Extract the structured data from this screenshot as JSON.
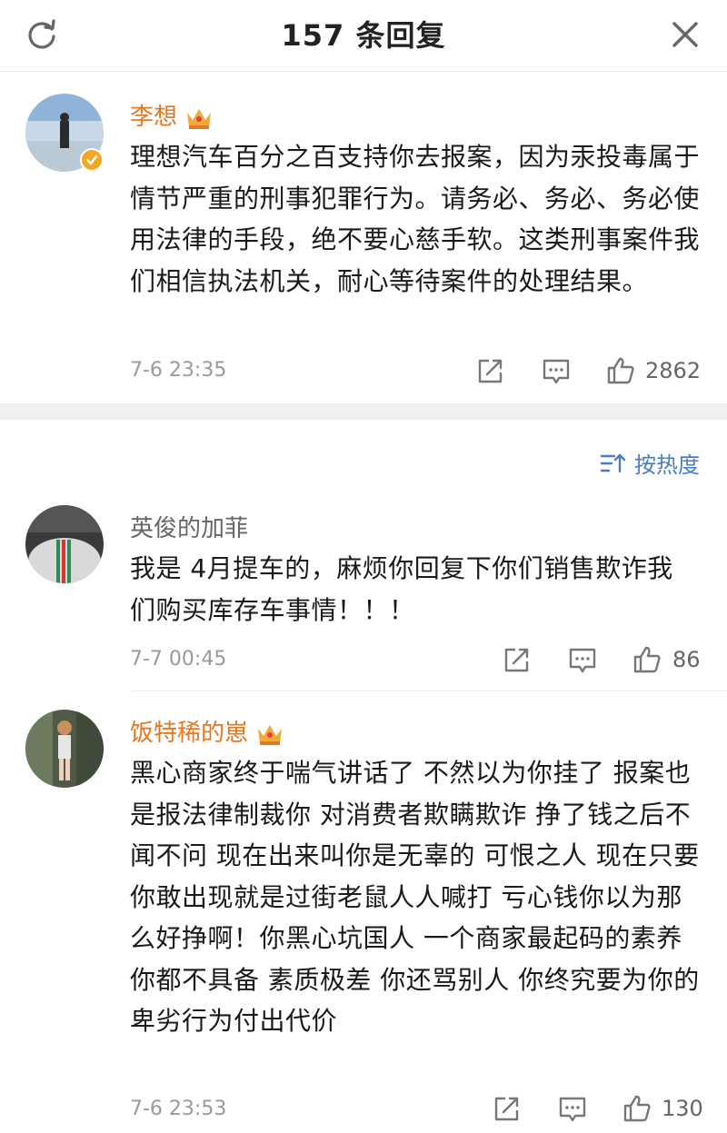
{
  "header": {
    "title": "157 条回复"
  },
  "main_comment": {
    "author": "李想",
    "text": "理想汽车百分之百支持你去报案，因为汞投毒属于情节严重的刑事犯罪行为。请务必、务必、务必使用法律的手段，绝不要心慈手软。这类刑事案件我们相信执法机关，耐心等待案件的处理结果。",
    "time": "7-6 23:35",
    "likes": "2862"
  },
  "sort": {
    "label": "按热度"
  },
  "replies": [
    {
      "author": "英俊的加菲",
      "text": "我是 4月提车的，麻烦你回复下你们销售欺诈我们购买库存车事情！！！",
      "time": "7-7 00:45",
      "likes": "86"
    },
    {
      "author": "饭特稀的崽",
      "text": "黑心商家终于喘气讲话了 不然以为你挂了 报案也是报法律制裁你 对消费者欺瞒欺诈 挣了钱之后不闻不问 现在出来叫你是无辜的 可恨之人 现在只要你敢出现就是过街老鼠人人喊打 亏心钱你以为那么好挣啊！你黑心坑国人 一个商家最起码的素养你都不具备 素质极差 你还骂别人 你终究要为你的卑劣行为付出代价",
      "time": "7-6 23:53",
      "likes": "130"
    }
  ],
  "colors": {
    "accent_orange": "#e8761c",
    "link_blue": "#4a7dbd",
    "meta_gray": "#9a9a9a"
  }
}
